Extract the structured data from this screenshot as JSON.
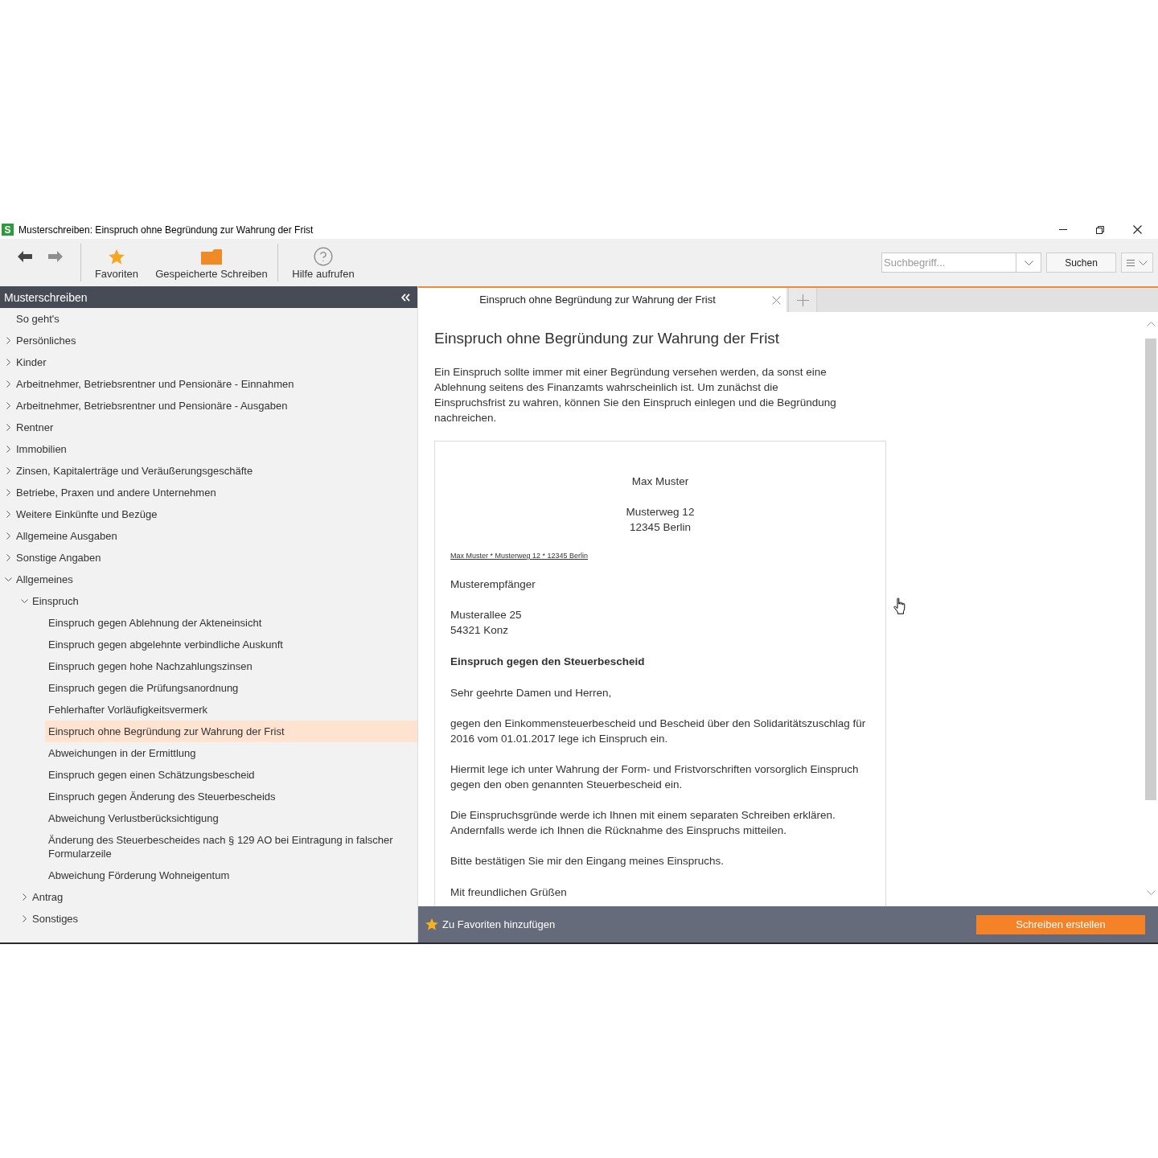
{
  "window": {
    "app_icon_text": "S",
    "title": "Musterschreiben: Einspruch ohne Begründung zur Wahrung der Frist"
  },
  "toolbar": {
    "navigation": [
      {
        "disabled": false
      },
      {
        "disabled": true
      }
    ],
    "items": [
      {
        "label": "Favoriten"
      },
      {
        "label": "Gespeicherte Schreiben"
      },
      {
        "label": "Hilfe aufrufen"
      }
    ],
    "search": {
      "placeholder": "Suchbegriff..."
    },
    "search_button": "Suchen"
  },
  "sidebar": {
    "title": "Musterschreiben",
    "items": [
      {
        "label": "So geht's",
        "selected": false
      },
      {
        "label": "Persönliches",
        "expanded": false,
        "selected": false
      },
      {
        "label": "Kinder",
        "expanded": false,
        "selected": false
      },
      {
        "label": "Arbeitnehmer, Betriebsrentner und Pensionäre - Einnahmen",
        "expanded": false,
        "selected": false
      },
      {
        "label": "Arbeitnehmer, Betriebsrentner und Pensionäre - Ausgaben",
        "expanded": false,
        "selected": false
      },
      {
        "label": "Rentner",
        "expanded": false,
        "selected": false
      },
      {
        "label": "Immobilien",
        "expanded": false,
        "selected": false
      },
      {
        "label": "Zinsen, Kapitalerträge und Veräußerungsgeschäfte",
        "expanded": false,
        "selected": false
      },
      {
        "label": "Betriebe, Praxen und andere Unternehmen",
        "expanded": false,
        "selected": false
      },
      {
        "label": "Weitere Einkünfte und Bezüge",
        "expanded": false,
        "selected": false
      },
      {
        "label": "Allgemeine Ausgaben",
        "expanded": false,
        "selected": false
      },
      {
        "label": "Sonstige Angaben",
        "expanded": false,
        "selected": false
      },
      {
        "label": "Allgemeines",
        "expanded": true,
        "selected": false,
        "children": [
          {
            "label": "Einspruch",
            "expanded": true,
            "selected": false,
            "children": [
              {
                "label": "Einspruch gegen Ablehnung der Akteneinsicht",
                "selected": false
              },
              {
                "label": "Einspruch gegen abgelehnte verbindliche Auskunft",
                "selected": false
              },
              {
                "label": "Einspruch gegen hohe Nachzahlungszinsen",
                "selected": false
              },
              {
                "label": "Einspruch gegen die Prüfungsanordnung",
                "selected": false
              },
              {
                "label": "Fehlerhafter Vorläufigkeitsvermerk",
                "selected": false
              },
              {
                "label": "Einspruch ohne Begründung zur Wahrung der Frist",
                "selected": true
              },
              {
                "label": "Abweichungen in der Ermittlung",
                "selected": false
              },
              {
                "label": "Einspruch gegen einen Schätzungsbescheid",
                "selected": false
              },
              {
                "label": "Einspruch gegen Änderung des Steuerbescheids",
                "selected": false
              },
              {
                "label": "Abweichung Verlustberücksichtigung",
                "selected": false
              },
              {
                "label": "Änderung des Steuerbescheides nach § 129 AO bei Eintragung in falscher Formularzeile",
                "selected": false
              },
              {
                "label": "Abweichung Förderung Wohneigentum",
                "selected": false
              }
            ]
          },
          {
            "label": "Antrag",
            "expanded": false,
            "selected": false
          },
          {
            "label": "Sonstiges",
            "expanded": false,
            "selected": false
          }
        ]
      }
    ]
  },
  "tabs": [
    {
      "label": "Einspruch ohne Begründung zur Wahrung der Frist",
      "selected": true
    }
  ],
  "document": {
    "heading": "Einspruch ohne Begründung zur Wahrung der Frist",
    "intro": "Ein Einspruch sollte immer mit einer Begründung versehen werden, da sonst eine Ablehnung seitens des Finanzamts wahrscheinlich ist. Um zunächst die Einspruchsfrist zu wahren, können Sie den Einspruch einlegen und die Begründung nachreichen.",
    "letter": {
      "sender_name": "Max Muster",
      "sender_address": [
        "Musterweg 12",
        "12345 Berlin"
      ],
      "return_address": "Max Muster * Musterweg 12 * 12345 Berlin",
      "recipient": "Musterempfänger",
      "recipient_address": [
        "Musterallee 25",
        "54321 Konz"
      ],
      "subject": "Einspruch gegen den Steuerbescheid",
      "salutation": "Sehr geehrte Damen und Herren,",
      "paragraphs": [
        "gegen den Einkommensteuerbescheid und Bescheid über den Solidaritätszuschlag für 2016 vom 01.01.2017 lege ich Einspruch ein.",
        "Hiermit lege ich unter Wahrung der Form- und Fristvorschriften vorsorglich Einspruch gegen den oben genannten Steuerbescheid ein.",
        "Die Einspruchsgründe werde ich Ihnen mit einem separaten Schreiben erklären. Andernfalls werde ich Ihnen die Rücknahme des Einspruchs mitteilen.",
        "Bitte bestätigen Sie mir den Eingang meines Einspruchs."
      ],
      "closing": "Mit freundlichen Grüßen"
    }
  },
  "bottom_bar": {
    "favorite_button": "Zu Favoriten hinzufügen",
    "create_button": "Schreiben erstellen"
  }
}
